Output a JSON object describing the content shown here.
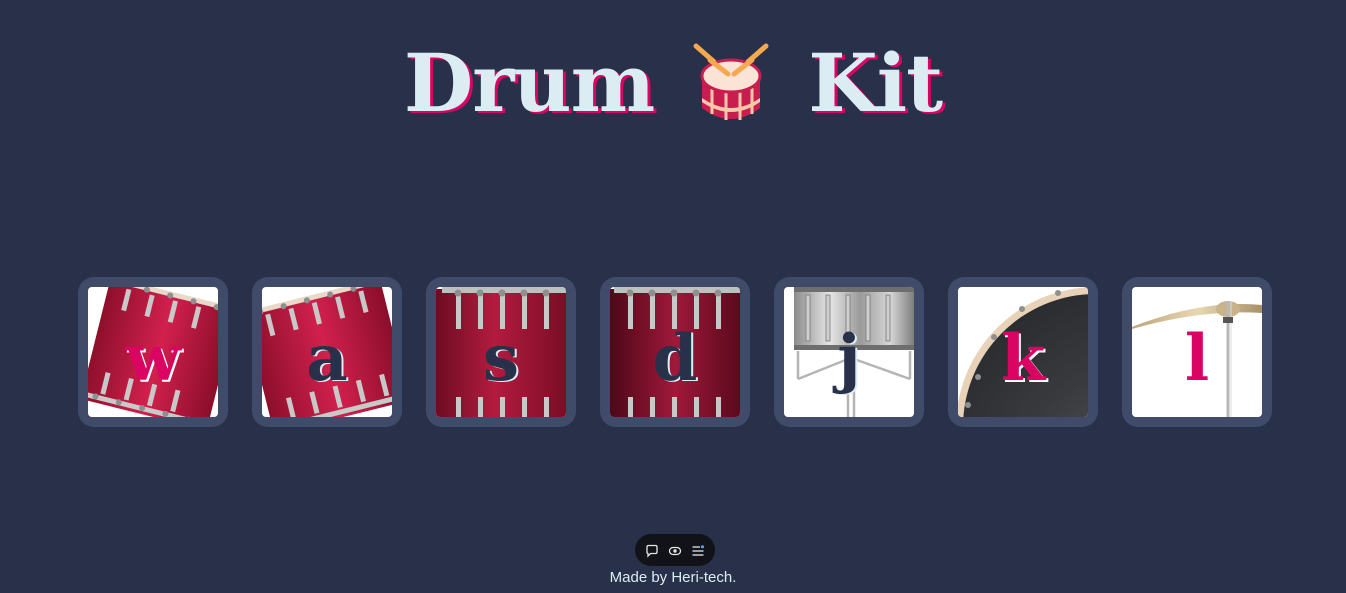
{
  "header": {
    "title_left": "Drum",
    "title_right": "Kit",
    "emoji_icon": "drum-icon"
  },
  "drums": [
    {
      "key": "w",
      "instrument": "tom-1",
      "key_color": "pink"
    },
    {
      "key": "a",
      "instrument": "tom-2",
      "key_color": "navy"
    },
    {
      "key": "s",
      "instrument": "tom-3",
      "key_color": "navy"
    },
    {
      "key": "d",
      "instrument": "tom-4",
      "key_color": "navy"
    },
    {
      "key": "j",
      "instrument": "snare",
      "key_color": "navy"
    },
    {
      "key": "k",
      "instrument": "kick-bass",
      "key_color": "pink"
    },
    {
      "key": "l",
      "instrument": "crash",
      "key_color": "pink"
    }
  ],
  "toolbar": {
    "icons": [
      "comment-icon",
      "eye-icon",
      "menu-icon"
    ]
  },
  "footer": {
    "text": "Made by Heri-tech."
  },
  "colors": {
    "background": "#283149",
    "button": "#404b69",
    "accent_pink": "#da0463",
    "light": "#dbedf3"
  }
}
